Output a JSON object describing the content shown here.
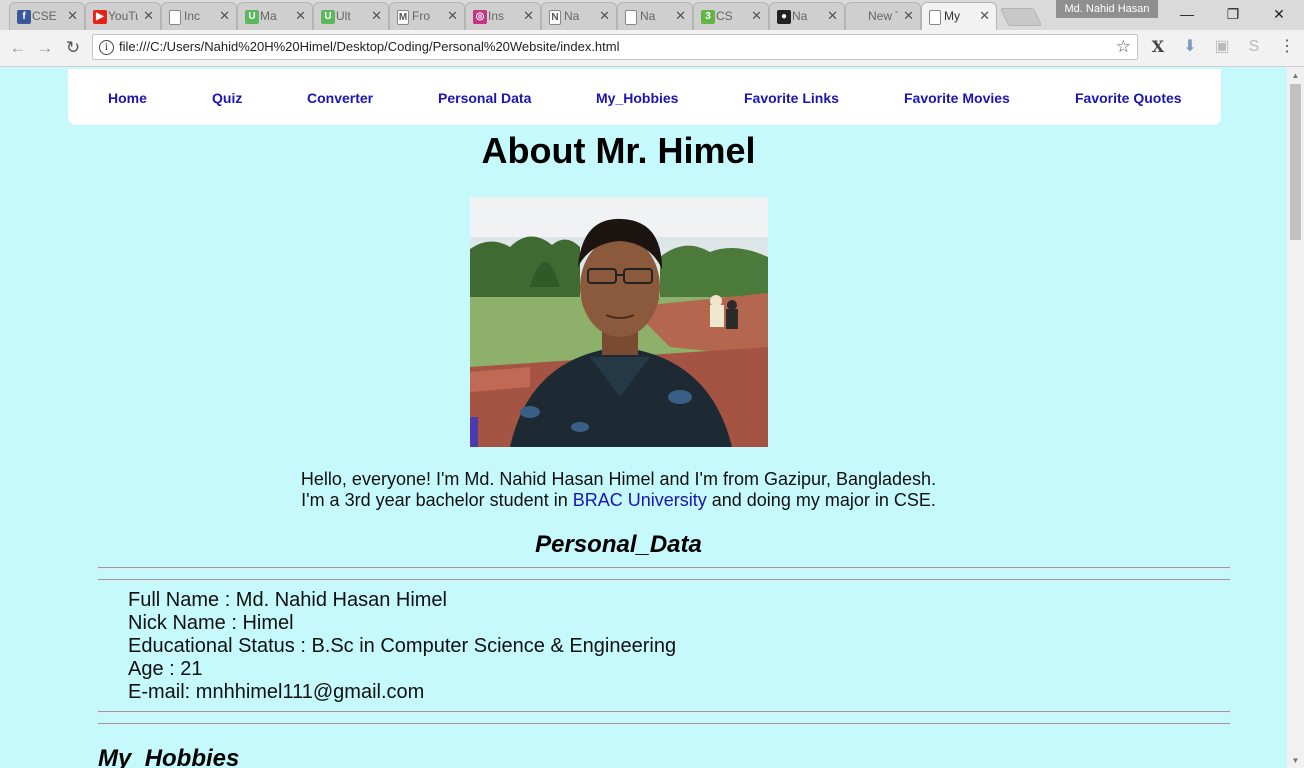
{
  "browser": {
    "tabs": [
      {
        "title": "CSE",
        "fav_color": "#3b5998",
        "fav_glyph": "f"
      },
      {
        "title": "YouTube",
        "fav_color": "#e62117",
        "fav_glyph": "▶"
      },
      {
        "title": "Inc",
        "fav_color": "#ffffff",
        "fav_glyph": ""
      },
      {
        "title": "Ma",
        "fav_color": "#5cb85c",
        "fav_glyph": "U"
      },
      {
        "title": "Ult",
        "fav_color": "#5cb85c",
        "fav_glyph": "U"
      },
      {
        "title": "Fro",
        "fav_color": "#ffffff",
        "fav_glyph": "M"
      },
      {
        "title": "Ins",
        "fav_color": "#c13584",
        "fav_glyph": "◎"
      },
      {
        "title": "Na",
        "fav_color": "#ffffff",
        "fav_glyph": "N"
      },
      {
        "title": "Na",
        "fav_color": "#ffffff",
        "fav_glyph": ""
      },
      {
        "title": "CS",
        "fav_color": "#64b544",
        "fav_glyph": "3"
      },
      {
        "title": "Na",
        "fav_color": "#222222",
        "fav_glyph": "●"
      },
      {
        "title": "New Ta",
        "fav_color": "",
        "fav_glyph": ""
      },
      {
        "title": "My",
        "fav_color": "#ffffff",
        "fav_glyph": ""
      }
    ],
    "profile_name": "Md. Nahid Hasan",
    "address_url": "file:///C:/Users/Nahid%20H%20Himel/Desktop/Coding/Personal%20Website/index.html"
  },
  "site": {
    "nav": [
      "Home",
      "Quiz",
      "Converter",
      "Personal Data",
      "My_Hobbies",
      "Favorite Links",
      "Favorite Movies",
      "Favorite Quotes"
    ],
    "heading": "About Mr. Himel",
    "intro": {
      "line1": "Hello, everyone! I'm Md. Nahid Hasan Himel and I'm from Gazipur, Bangladesh.",
      "line2_before": "I'm a 3rd year bachelor student in ",
      "link": "BRAC University",
      "line2_after": " and doing my major in CSE."
    },
    "personal_data_title": "Personal_Data",
    "details": [
      "Full Name : Md. Nahid Hasan Himel",
      "Nick Name : Himel",
      "Educational Status : B.Sc in Computer Science & Engineering",
      "Age : 21",
      "E-mail: mnhhimel111@gmail.com"
    ],
    "hobbies_title": "My_Hobbies"
  },
  "colors": {
    "page_bg": "#c5f9fc",
    "link": "#1c14b4"
  }
}
